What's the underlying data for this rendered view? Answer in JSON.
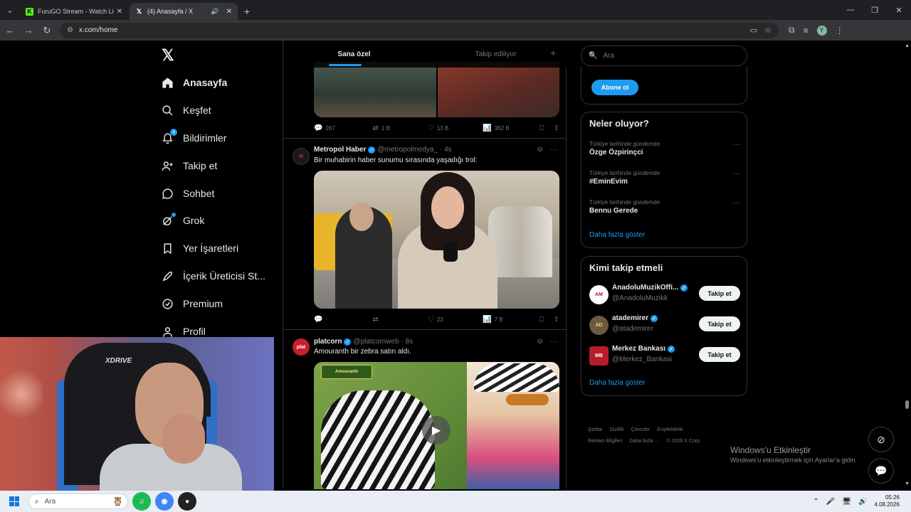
{
  "browser": {
    "tabs": [
      {
        "title": "FuruGO Stream - Watch Live or",
        "active": false
      },
      {
        "title": "(4) Anasayfa / X",
        "active": true
      }
    ],
    "url": "x.com/home"
  },
  "sidebar": {
    "items": [
      {
        "label": "Anasayfa",
        "icon": "home-icon"
      },
      {
        "label": "Keşfet",
        "icon": "search-icon"
      },
      {
        "label": "Bildirimler",
        "icon": "bell-icon",
        "badge": "4"
      },
      {
        "label": "Takip et",
        "icon": "follow-icon"
      },
      {
        "label": "Sohbet",
        "icon": "chat-icon"
      },
      {
        "label": "Grok",
        "icon": "grok-icon"
      },
      {
        "label": "Yer İşaretleri",
        "icon": "bookmark-icon"
      },
      {
        "label": "İçerik Üreticisi St...",
        "icon": "rocket-icon"
      },
      {
        "label": "Premium",
        "icon": "premium-icon"
      },
      {
        "label": "Profil",
        "icon": "person-icon"
      }
    ]
  },
  "feed": {
    "tabs": [
      "Sana özel",
      "Takip ediliyor"
    ],
    "post0_actions": {
      "reply": "267",
      "repost": "1 B",
      "like": "13 B",
      "views": "362 B"
    },
    "posts": [
      {
        "name": "Metropol Haber",
        "handle": "@metropolmedya_",
        "time": "· 4s",
        "text": "Bir muhabirin haber sunumu sırasında yaşadığı trol:",
        "actions": {
          "reply": "",
          "repost": "",
          "like": "23",
          "views": "7 B"
        }
      },
      {
        "name": "platcorn",
        "handle": "@platcornweb",
        "time": "· 8s",
        "text": "Amouranth bir zebra satın aldı.",
        "media_tag": "Amouranth"
      }
    ]
  },
  "right": {
    "search_placeholder": "Ara",
    "subscribe": "Abone ol",
    "trends_title": "Neler oluyor?",
    "trends": [
      {
        "context": "Türkiye tarihinde gündemde",
        "name": "Özge Özpirinçci"
      },
      {
        "context": "Türkiye tarihinde gündemde",
        "name": "#EminEvim"
      },
      {
        "context": "Türkiye tarihinde gündemde",
        "name": "Bennu Gerede"
      }
    ],
    "show_more": "Daha fazla göster",
    "who_title": "Kimi takip etmeli",
    "who": [
      {
        "name": "AnadoluMuzikOffi...",
        "handle": "@AnadoluMuzikk",
        "button": "Takip et"
      },
      {
        "name": "atademirer",
        "handle": "@atademirer",
        "button": "Takip et"
      },
      {
        "name": "Merkez Bankası",
        "handle": "@Merkez_Bankasi",
        "button": "Takip et"
      }
    ],
    "who_show_more": "Daha fazla göster",
    "footer": [
      "Şartlar",
      "Gizlilik",
      "Çerezler",
      "Erişilebilirlik",
      "Reklam Bilgileri",
      "Daha fazla ···",
      "© 2026 X Corp."
    ]
  },
  "watermark": {
    "title": "Windows'u Etkinleştir",
    "subtitle": "Windows'u etkinleştirmek için Ayarlar'a gidin."
  },
  "webcam": {
    "brand": "XDRIVE"
  },
  "taskbar": {
    "search": "Ara",
    "time": "05:26",
    "date": "4.08.2026"
  }
}
